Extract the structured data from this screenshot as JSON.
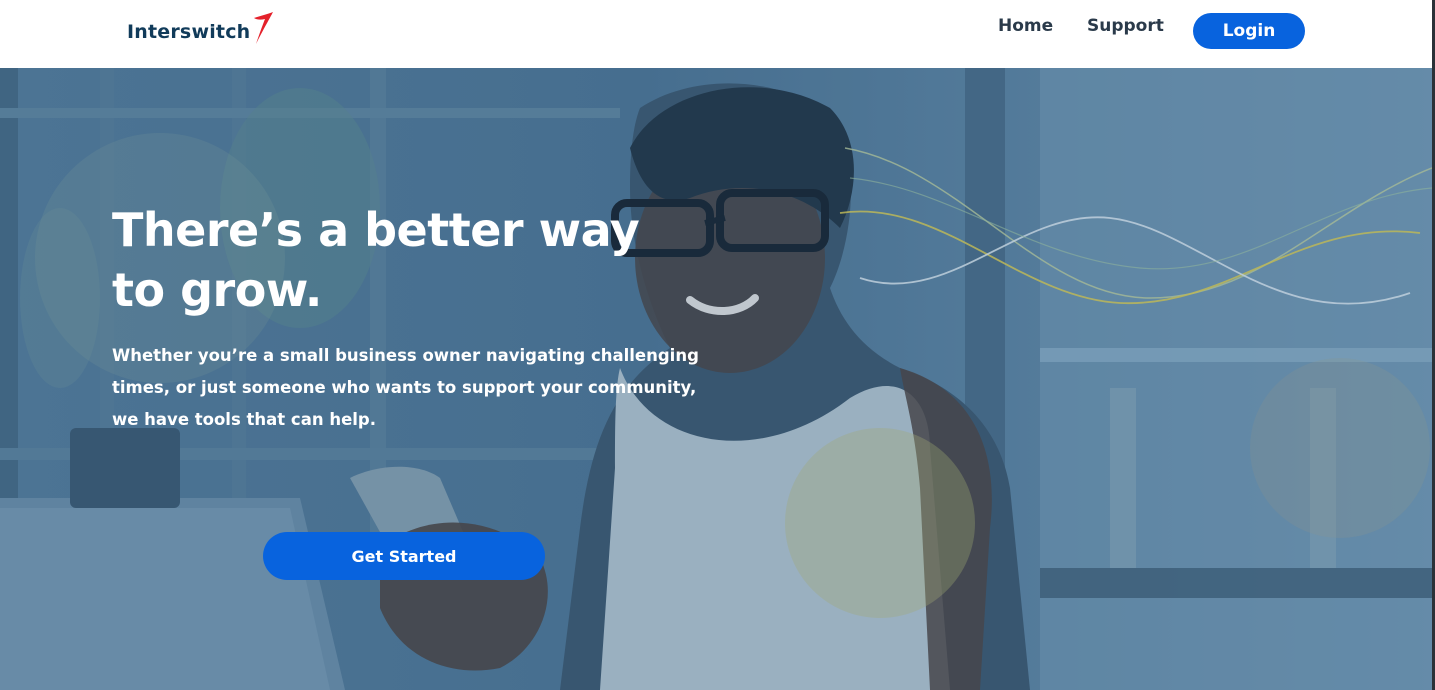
{
  "header": {
    "logo_text": "Interswitch",
    "nav": {
      "home_label": "Home",
      "support_label": "Support",
      "login_label": "Login"
    }
  },
  "hero": {
    "title": "There’s a better way to grow.",
    "subtitle": "Whether you’re a small business owner navigating challenging times, or just someone who wants to support your community, we have tools that can help.",
    "cta_label": "Get Started",
    "image": "woman-smiling-at-phone-photo"
  },
  "colors": {
    "brand_blue": "#0863de",
    "logo_navy": "#113b5a",
    "logo_red": "#e4212b",
    "nav_text": "#2a3a4a",
    "hero_overlay": "#4f7491"
  }
}
